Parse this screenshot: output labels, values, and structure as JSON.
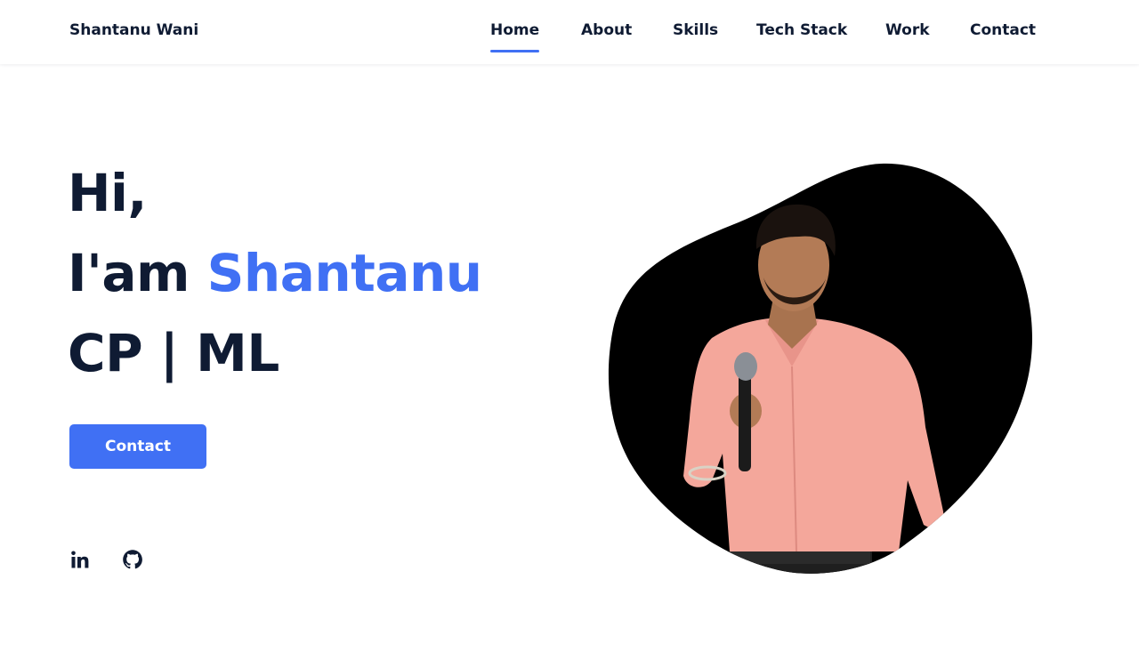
{
  "header": {
    "logo": "Shantanu Wani",
    "nav": [
      {
        "label": "Home",
        "active": true
      },
      {
        "label": "About",
        "active": false
      },
      {
        "label": "Skills",
        "active": false
      },
      {
        "label": "Tech Stack",
        "active": false
      },
      {
        "label": "Work",
        "active": false
      },
      {
        "label": "Contact",
        "active": false
      }
    ]
  },
  "hero": {
    "greeting": "Hi,",
    "intro_prefix": "I'am",
    "name": "Shantanu",
    "roles": "CP | ML",
    "button_label": "Contact"
  },
  "social": [
    {
      "icon": "linkedin-icon"
    },
    {
      "icon": "github-icon"
    }
  ],
  "colors": {
    "accent": "#4070f4",
    "text": "#0f1b33",
    "blob": "#000000"
  }
}
